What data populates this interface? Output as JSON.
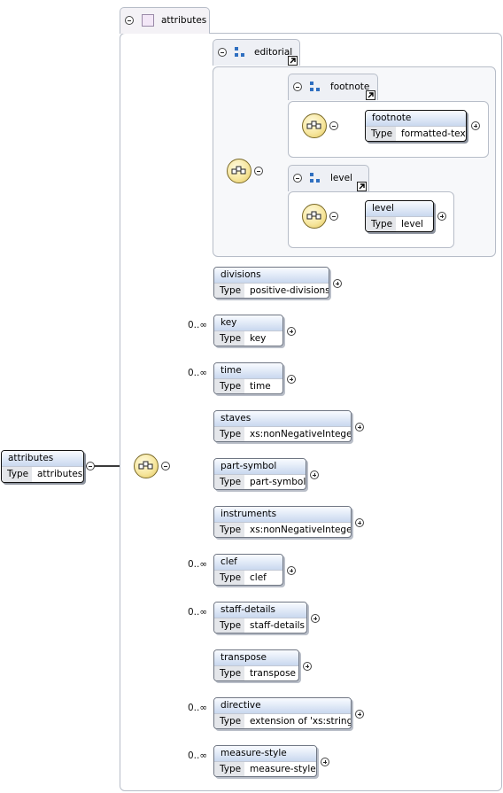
{
  "root": {
    "name": "attributes",
    "type_label": "Type",
    "type_value": "attributes"
  },
  "complex_type": {
    "title": "attributes"
  },
  "editorial": {
    "title": "editorial"
  },
  "footnote_group": {
    "title": "footnote"
  },
  "footnote_el": {
    "name": "footnote",
    "type_label": "Type",
    "type_value": "formatted-text"
  },
  "level_group": {
    "title": "level"
  },
  "level_el": {
    "name": "level",
    "type_label": "Type",
    "type_value": "level"
  },
  "children": [
    {
      "name": "divisions",
      "type_label": "Type",
      "type_value": "positive-divisions",
      "card": ""
    },
    {
      "name": "key",
      "type_label": "Type",
      "type_value": "key",
      "card": "0..∞"
    },
    {
      "name": "time",
      "type_label": "Type",
      "type_value": "time",
      "card": "0..∞"
    },
    {
      "name": "staves",
      "type_label": "Type",
      "type_value": "xs:nonNegativeInteger",
      "card": ""
    },
    {
      "name": "part-symbol",
      "type_label": "Type",
      "type_value": "part-symbol",
      "card": ""
    },
    {
      "name": "instruments",
      "type_label": "Type",
      "type_value": "xs:nonNegativeInteger",
      "card": ""
    },
    {
      "name": "clef",
      "type_label": "Type",
      "type_value": "clef",
      "card": "0..∞"
    },
    {
      "name": "staff-details",
      "type_label": "Type",
      "type_value": "staff-details",
      "card": "0..∞"
    },
    {
      "name": "transpose",
      "type_label": "Type",
      "type_value": "transpose",
      "card": ""
    },
    {
      "name": "directive",
      "type_label": "Type",
      "type_value": "extension of 'xs:string'",
      "card": "0..∞"
    },
    {
      "name": "measure-style",
      "type_label": "Type",
      "type_value": "measure-style",
      "card": "0..∞"
    }
  ],
  "colors": {
    "header_gradient_top": "#f9fbff",
    "header_gradient_bottom": "#c9d8ef",
    "sequence_icon": "#f7e7a0",
    "group_icon": "#2f6fc0"
  }
}
